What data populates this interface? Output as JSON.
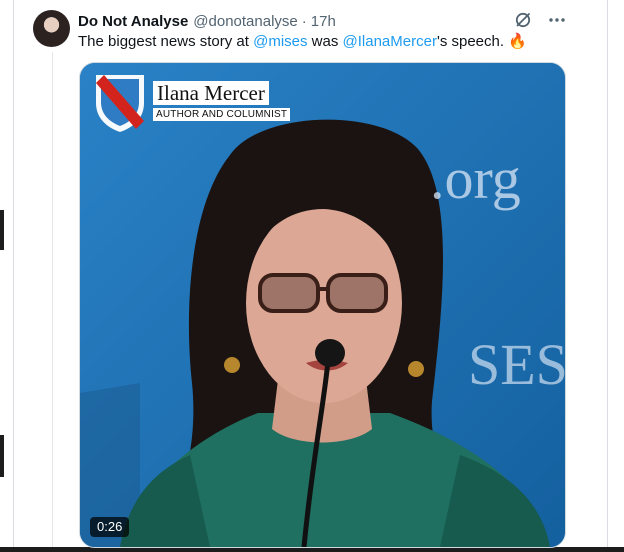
{
  "tweet": {
    "author_name": "Do Not Analyse",
    "handle": "@donotanalyse",
    "separator": "·",
    "time": "17h",
    "text_part1": "The biggest news story at ",
    "mention1": "@mises",
    "text_part2": " was ",
    "mention2": "@IlanaMercer",
    "text_part3": "'s speech. ",
    "emoji": "🔥",
    "mention_color": "#1d9bf0"
  },
  "icons": {
    "grok": "grok-icon",
    "more": "more-icon",
    "logo": "mises-shield-logo-icon"
  },
  "video": {
    "lower_third_name": "Ilana Mercer",
    "lower_third_title": "AUTHOR AND COLUMNIST",
    "backdrop_text_1": ".org",
    "backdrop_text_2": "SES",
    "duration": "0:26"
  }
}
